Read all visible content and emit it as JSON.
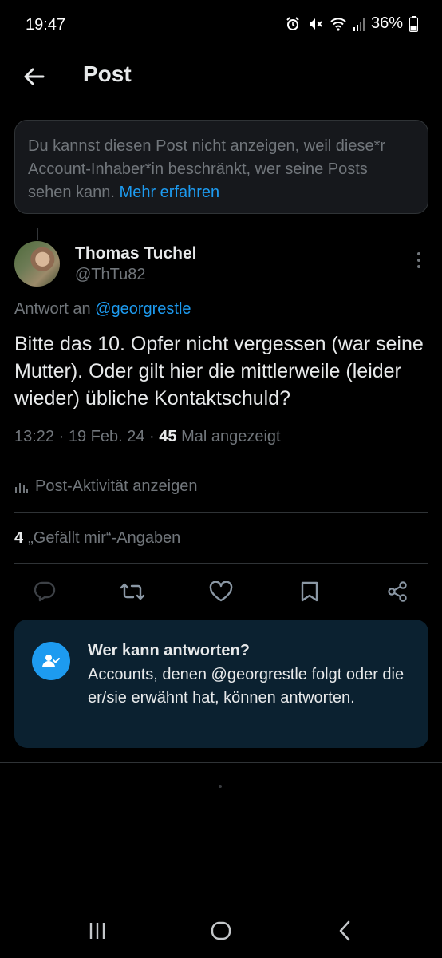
{
  "status_bar": {
    "time": "19:47",
    "battery": "36%"
  },
  "header": {
    "title": "Post"
  },
  "notice": {
    "text": "Du kannst diesen Post nicht anzeigen, weil diese*r Account-Inhaber*in beschränkt, wer seine Posts sehen kann.",
    "link": "Mehr erfahren"
  },
  "post": {
    "author_name": "Thomas Tuchel",
    "author_handle": "@ThTu82",
    "reply_prefix": "Antwort an",
    "reply_mention": "@georgrestle",
    "text": "Bitte das 10. Opfer nicht vergessen (war seine Mutter). Oder gilt hier die mittlerweile (leider wieder) übliche Kontaktschuld?",
    "time": "13:22",
    "date": "19 Feb. 24",
    "views_count": "45",
    "views_label": "Mal angezeigt",
    "activity_label": "Post-Aktivität anzeigen",
    "likes_count": "4",
    "likes_label": "„Gefällt mir“-Angaben"
  },
  "reply_card": {
    "title": "Wer kann antworten?",
    "text": "Accounts, denen @georgrestle folgt oder die er/sie erwähnt hat, können antworten."
  },
  "colors": {
    "accent": "#1d9bf0",
    "background": "#000000",
    "secondary_text": "#71767b",
    "card_bg": "#0b2130"
  }
}
